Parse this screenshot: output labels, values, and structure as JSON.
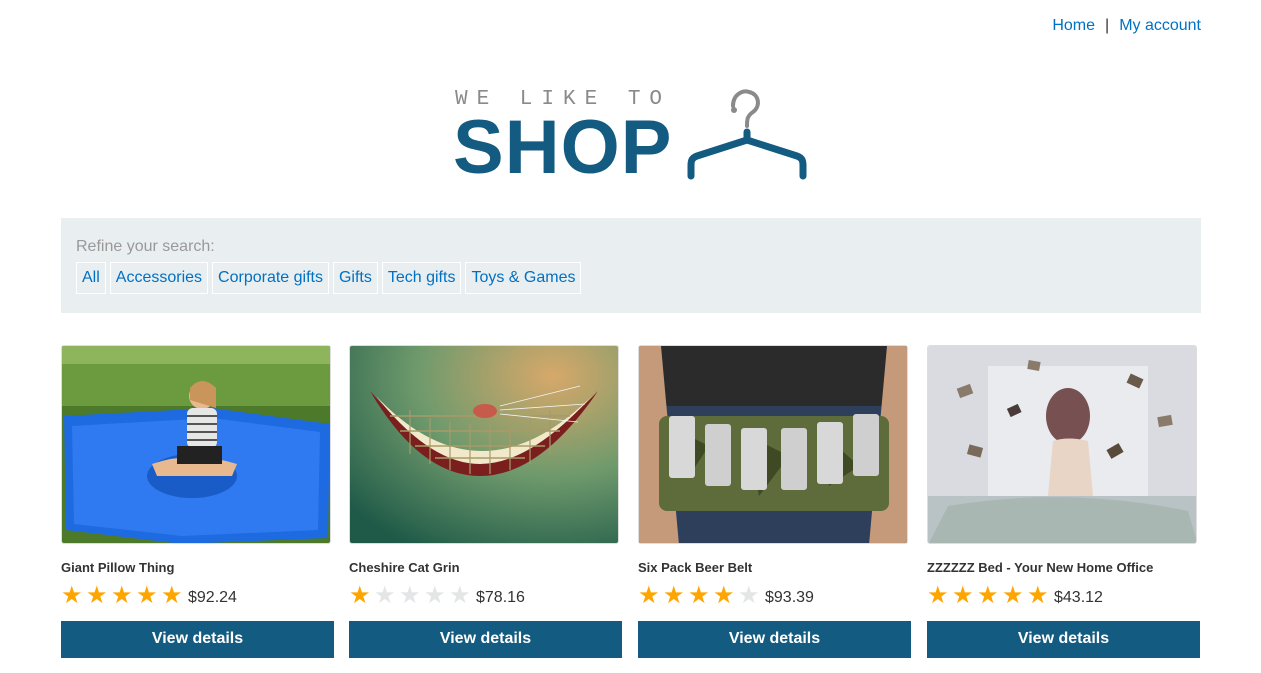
{
  "nav": {
    "home": "Home",
    "separator": "|",
    "account": "My account"
  },
  "logo": {
    "small_text": "WE LIKE TO",
    "big_text": "SHOP"
  },
  "refine": {
    "label": "Refine your search:",
    "filters": [
      "All",
      "Accessories",
      "Corporate gifts",
      "Gifts",
      "Tech gifts",
      "Toys & Games"
    ]
  },
  "products": [
    {
      "name": "Giant Pillow Thing",
      "rating": 5,
      "price": "$92.24",
      "button": "View details"
    },
    {
      "name": "Cheshire Cat Grin",
      "rating": 1,
      "price": "$78.16",
      "button": "View details"
    },
    {
      "name": "Six Pack Beer Belt",
      "rating": 4,
      "price": "$93.39",
      "button": "View details"
    },
    {
      "name": "ZZZZZZ Bed - Your New Home Office",
      "rating": 5,
      "price": "$43.12",
      "button": "View details"
    }
  ],
  "colors": {
    "link": "#0071c2",
    "brand": "#135b80",
    "star": "#ffa500",
    "star_off": "#e3e5e6",
    "panel": "#e9eef1"
  }
}
